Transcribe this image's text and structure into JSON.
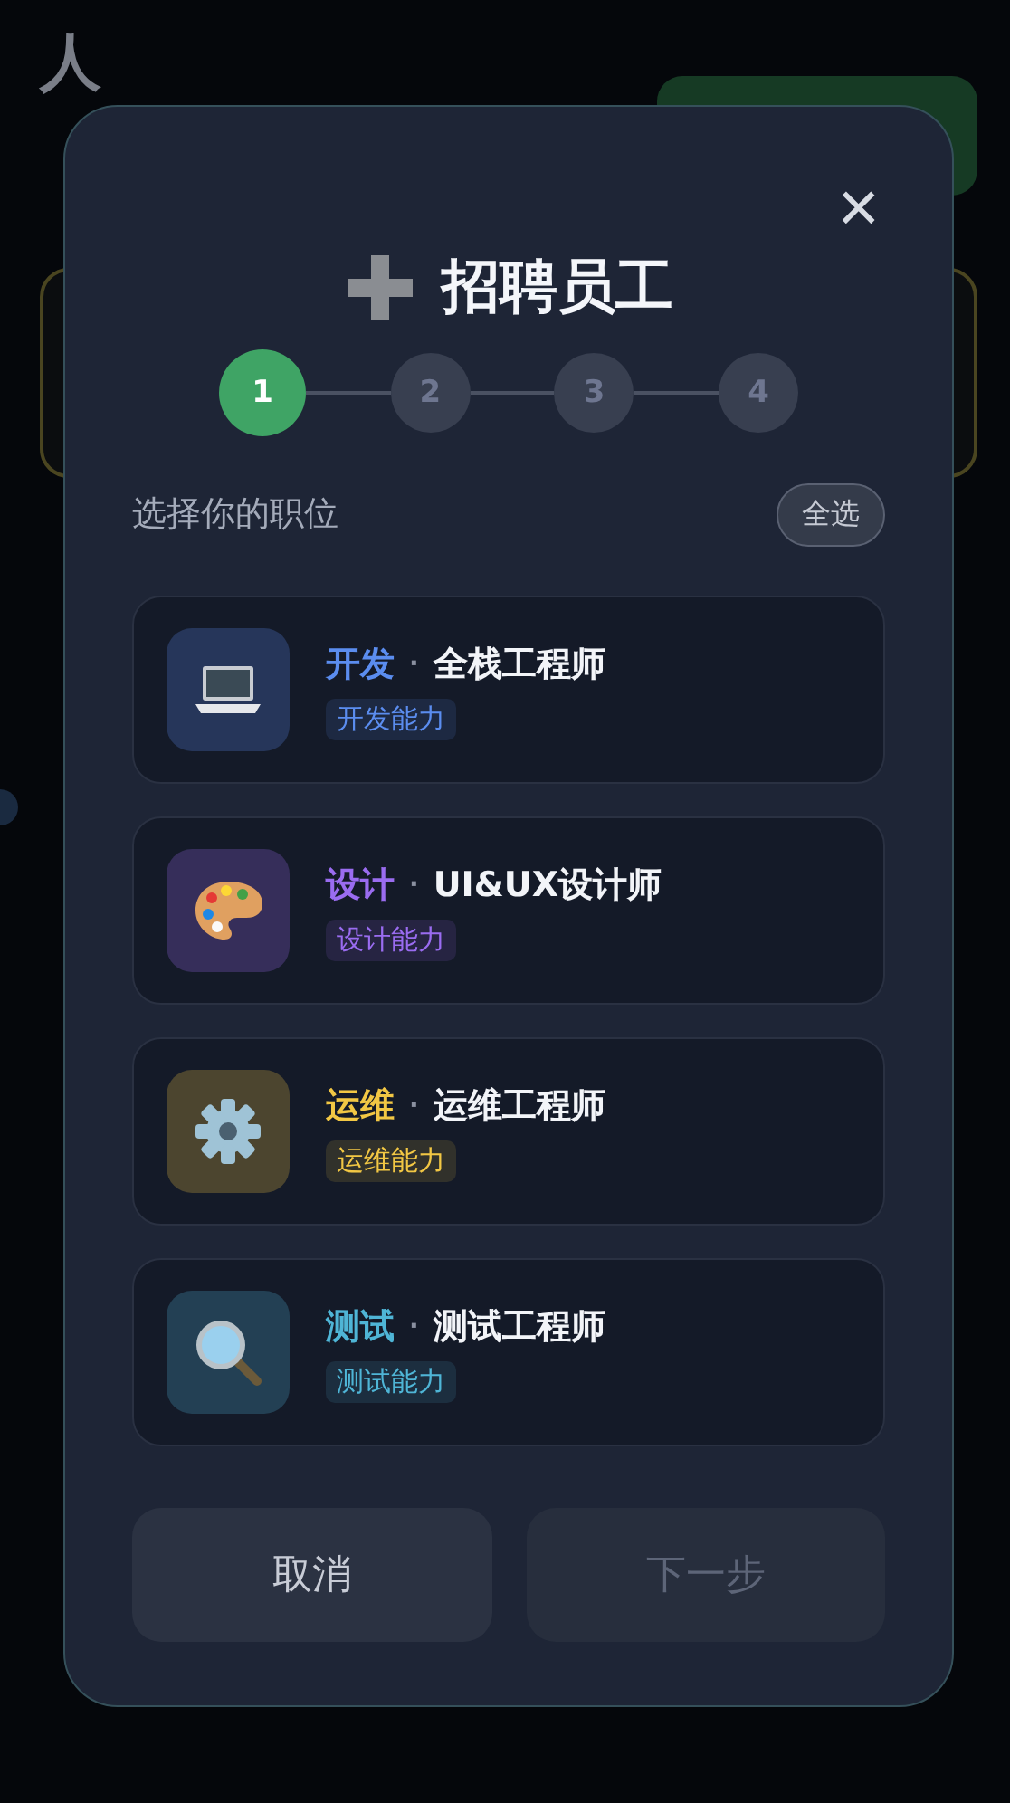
{
  "page": {
    "title": "人"
  },
  "dialog": {
    "title": "招聘员工",
    "close": "×",
    "steps": [
      {
        "label": "1",
        "selected": true
      },
      {
        "label": "2",
        "selected": false
      },
      {
        "label": "3",
        "selected": false
      },
      {
        "label": "4",
        "selected": false
      }
    ],
    "section_label": "选择你的职位",
    "select_all": "全选",
    "roles": [
      {
        "category": "开发",
        "separator": "·",
        "title": "全栈工程师",
        "tag": "开发能力",
        "color": "#5b8def"
      },
      {
        "category": "设计",
        "separator": "·",
        "title": "UI&UX设计师",
        "tag": "设计能力",
        "color": "#9a6cf0"
      },
      {
        "category": "运维",
        "separator": "·",
        "title": "运维工程师",
        "tag": "运维能力",
        "color": "#f2c744"
      },
      {
        "category": "测试",
        "separator": "·",
        "title": "测试工程师",
        "tag": "测试能力",
        "color": "#4fb5d6"
      }
    ],
    "buttons": [
      {
        "label": "取消",
        "disabled": false
      },
      {
        "label": "下一步",
        "disabled": true
      }
    ]
  }
}
